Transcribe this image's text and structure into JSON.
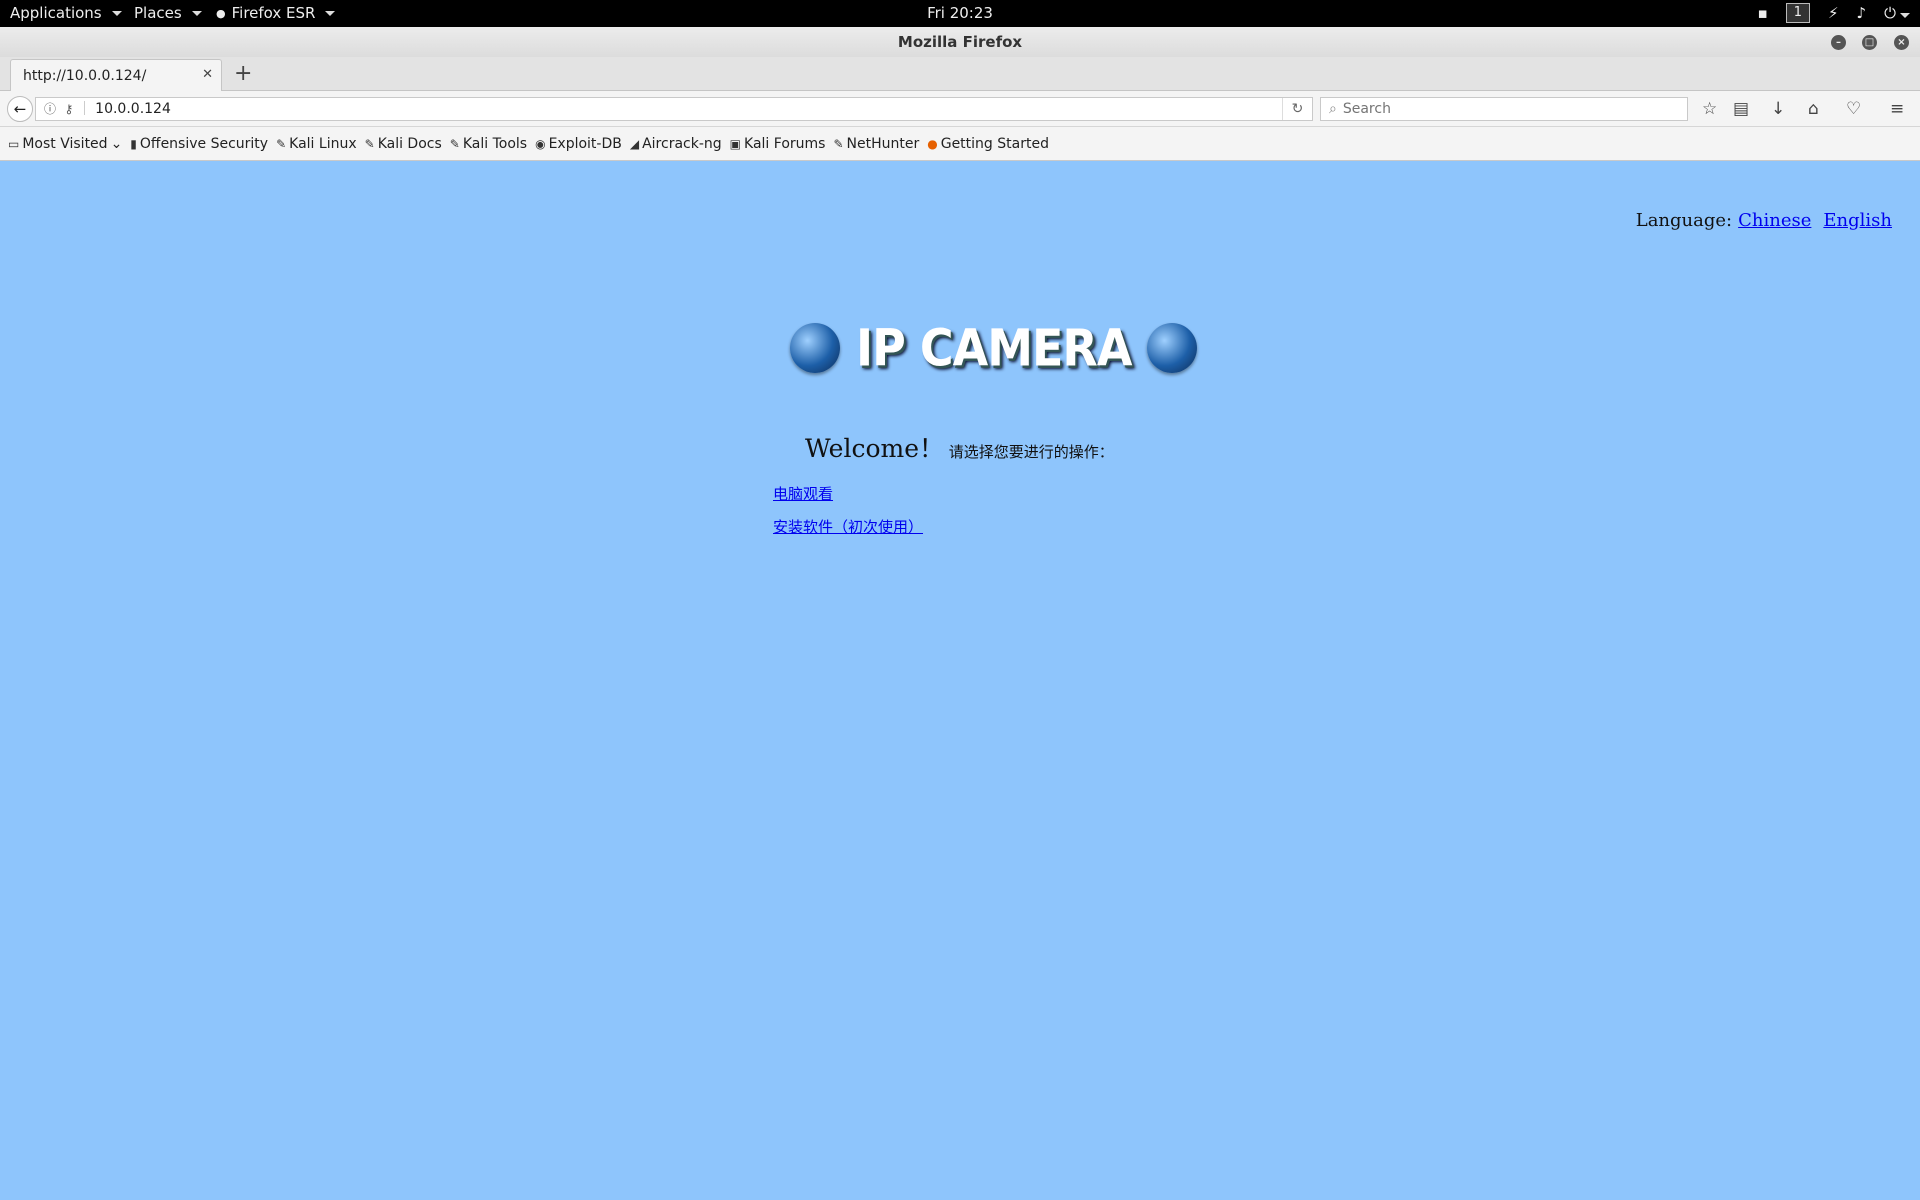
{
  "topbar": {
    "applications": "Applications",
    "places": "Places",
    "firefox_esr": "Firefox ESR",
    "clock": "Fri 20:23",
    "workspace": "1"
  },
  "window": {
    "title": "Mozilla Firefox"
  },
  "tab": {
    "title": "http://10.0.0.124/"
  },
  "navbar": {
    "url": "10.0.0.124",
    "search_placeholder": "Search"
  },
  "bookmarks": [
    {
      "label": "Most Visited",
      "icon": "folder-icon"
    },
    {
      "label": "Offensive Security",
      "icon": "offsec-icon"
    },
    {
      "label": "Kali Linux",
      "icon": "kali-icon"
    },
    {
      "label": "Kali Docs",
      "icon": "kali-icon"
    },
    {
      "label": "Kali Tools",
      "icon": "kali-icon"
    },
    {
      "label": "Exploit-DB",
      "icon": "exploitdb-icon"
    },
    {
      "label": "Aircrack-ng",
      "icon": "aircrack-icon"
    },
    {
      "label": "Kali Forums",
      "icon": "forums-icon"
    },
    {
      "label": "NetHunter",
      "icon": "kali-icon"
    },
    {
      "label": "Getting Started",
      "icon": "firefox-icon"
    }
  ],
  "page": {
    "language_label": "Language:",
    "lang_chinese": "Chinese",
    "lang_english": "English",
    "logo_text": "IP CAMERA",
    "welcome": "Welcome！",
    "welcome_cn": "请选择您要进行的操作：",
    "link_view": "电脑观看",
    "link_install": "安装软件（初次使用）"
  },
  "colors": {
    "page_background": "#8ec5fc",
    "link": "#0000ee"
  }
}
